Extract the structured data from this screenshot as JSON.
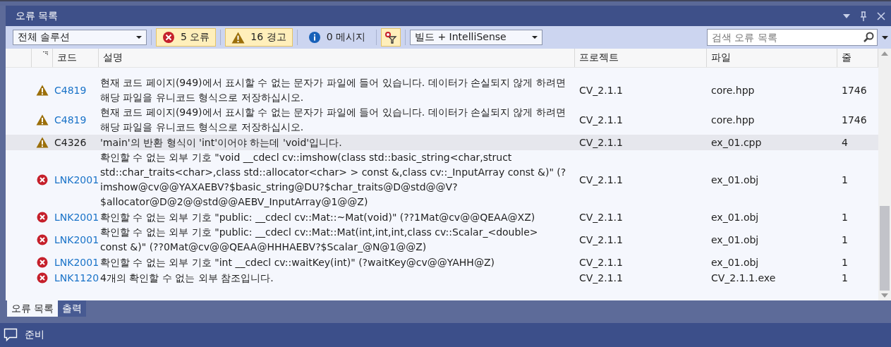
{
  "window": {
    "title": "오류 목록"
  },
  "toolbar": {
    "scope": "전체 솔루션",
    "filters": [
      {
        "kind": "error",
        "label": "5 오류",
        "selected": true
      },
      {
        "kind": "warning",
        "label": "16 경고",
        "selected": true
      },
      {
        "kind": "message",
        "label": "0 메시지",
        "selected": false
      }
    ],
    "filter_toggle": {
      "selected": true
    },
    "source": "빌드 + IntelliSense",
    "search": {
      "placeholder": "검색 오류 목록"
    }
  },
  "table": {
    "columns": [
      "코드",
      "설명",
      "프로젝트",
      "파일",
      "줄"
    ],
    "rows": [
      {
        "kind": "warning",
        "code": "C4819",
        "link": true,
        "description": "현재 코드 페이지(949)에서 표시할 수 없는 문자가 파일에 들어 있습니다. 데이터가 손실되지 않게 하려면 해당 파일을 유니코드 형식으로 저장하십시오.",
        "project": "CV_2.1.1",
        "file": "core.hpp",
        "line": "1746",
        "selected": false
      },
      {
        "kind": "warning",
        "code": "C4819",
        "link": true,
        "description": "현재 코드 페이지(949)에서 표시할 수 없는 문자가 파일에 들어 있습니다. 데이터가 손실되지 않게 하려면 해당 파일을 유니코드 형식으로 저장하십시오.",
        "project": "CV_2.1.1",
        "file": "core.hpp",
        "line": "1746",
        "selected": false
      },
      {
        "kind": "warning",
        "code": "C4326",
        "link": false,
        "description": "'main'의 반환 형식이 'int'이어야 하는데 'void'입니다.",
        "project": "CV_2.1.1",
        "file": "ex_01.cpp",
        "line": "4",
        "selected": true
      },
      {
        "kind": "error",
        "code": "LNK2001",
        "link": true,
        "description": "확인할 수 없는 외부 기호 \"void __cdecl cv::imshow(class std::basic_string<char,struct std::char_traits<char>,class std::allocator<char> > const &,class cv::_InputArray const &)\" (?imshow@cv@@YAXAEBV?$basic_string@DU?$char_traits@D@std@@V?$allocator@D@2@@std@@AEBV_InputArray@1@@Z)",
        "project": "CV_2.1.1",
        "file": "ex_01.obj",
        "line": "1",
        "selected": false
      },
      {
        "kind": "error",
        "code": "LNK2001",
        "link": true,
        "description": "확인할 수 없는 외부 기호 \"public: __cdecl cv::Mat::~Mat(void)\" (??1Mat@cv@@QEAA@XZ)",
        "project": "CV_2.1.1",
        "file": "ex_01.obj",
        "line": "1",
        "selected": false
      },
      {
        "kind": "error",
        "code": "LNK2001",
        "link": true,
        "description": "확인할 수 없는 외부 기호 \"public: __cdecl cv::Mat::Mat(int,int,int,class cv::Scalar_<double> const &)\" (??0Mat@cv@@QEAA@HHHAEBV?$Scalar_@N@1@@Z)",
        "project": "CV_2.1.1",
        "file": "ex_01.obj",
        "line": "1",
        "selected": false
      },
      {
        "kind": "error",
        "code": "LNK2001",
        "link": true,
        "description": "확인할 수 없는 외부 기호 \"int __cdecl cv::waitKey(int)\" (?waitKey@cv@@YAHH@Z)",
        "project": "CV_2.1.1",
        "file": "ex_01.obj",
        "line": "1",
        "selected": false
      },
      {
        "kind": "error",
        "code": "LNK1120",
        "link": true,
        "description": "4개의 확인할 수 없는 외부 참조입니다.",
        "project": "CV_2.1.1",
        "file": "CV_2.1.1.exe",
        "line": "1",
        "selected": false
      }
    ]
  },
  "tabs": [
    {
      "label": "오류 목록",
      "selected": true
    },
    {
      "label": "출력",
      "selected": false
    }
  ],
  "status_bar": {
    "text": "준비"
  }
}
